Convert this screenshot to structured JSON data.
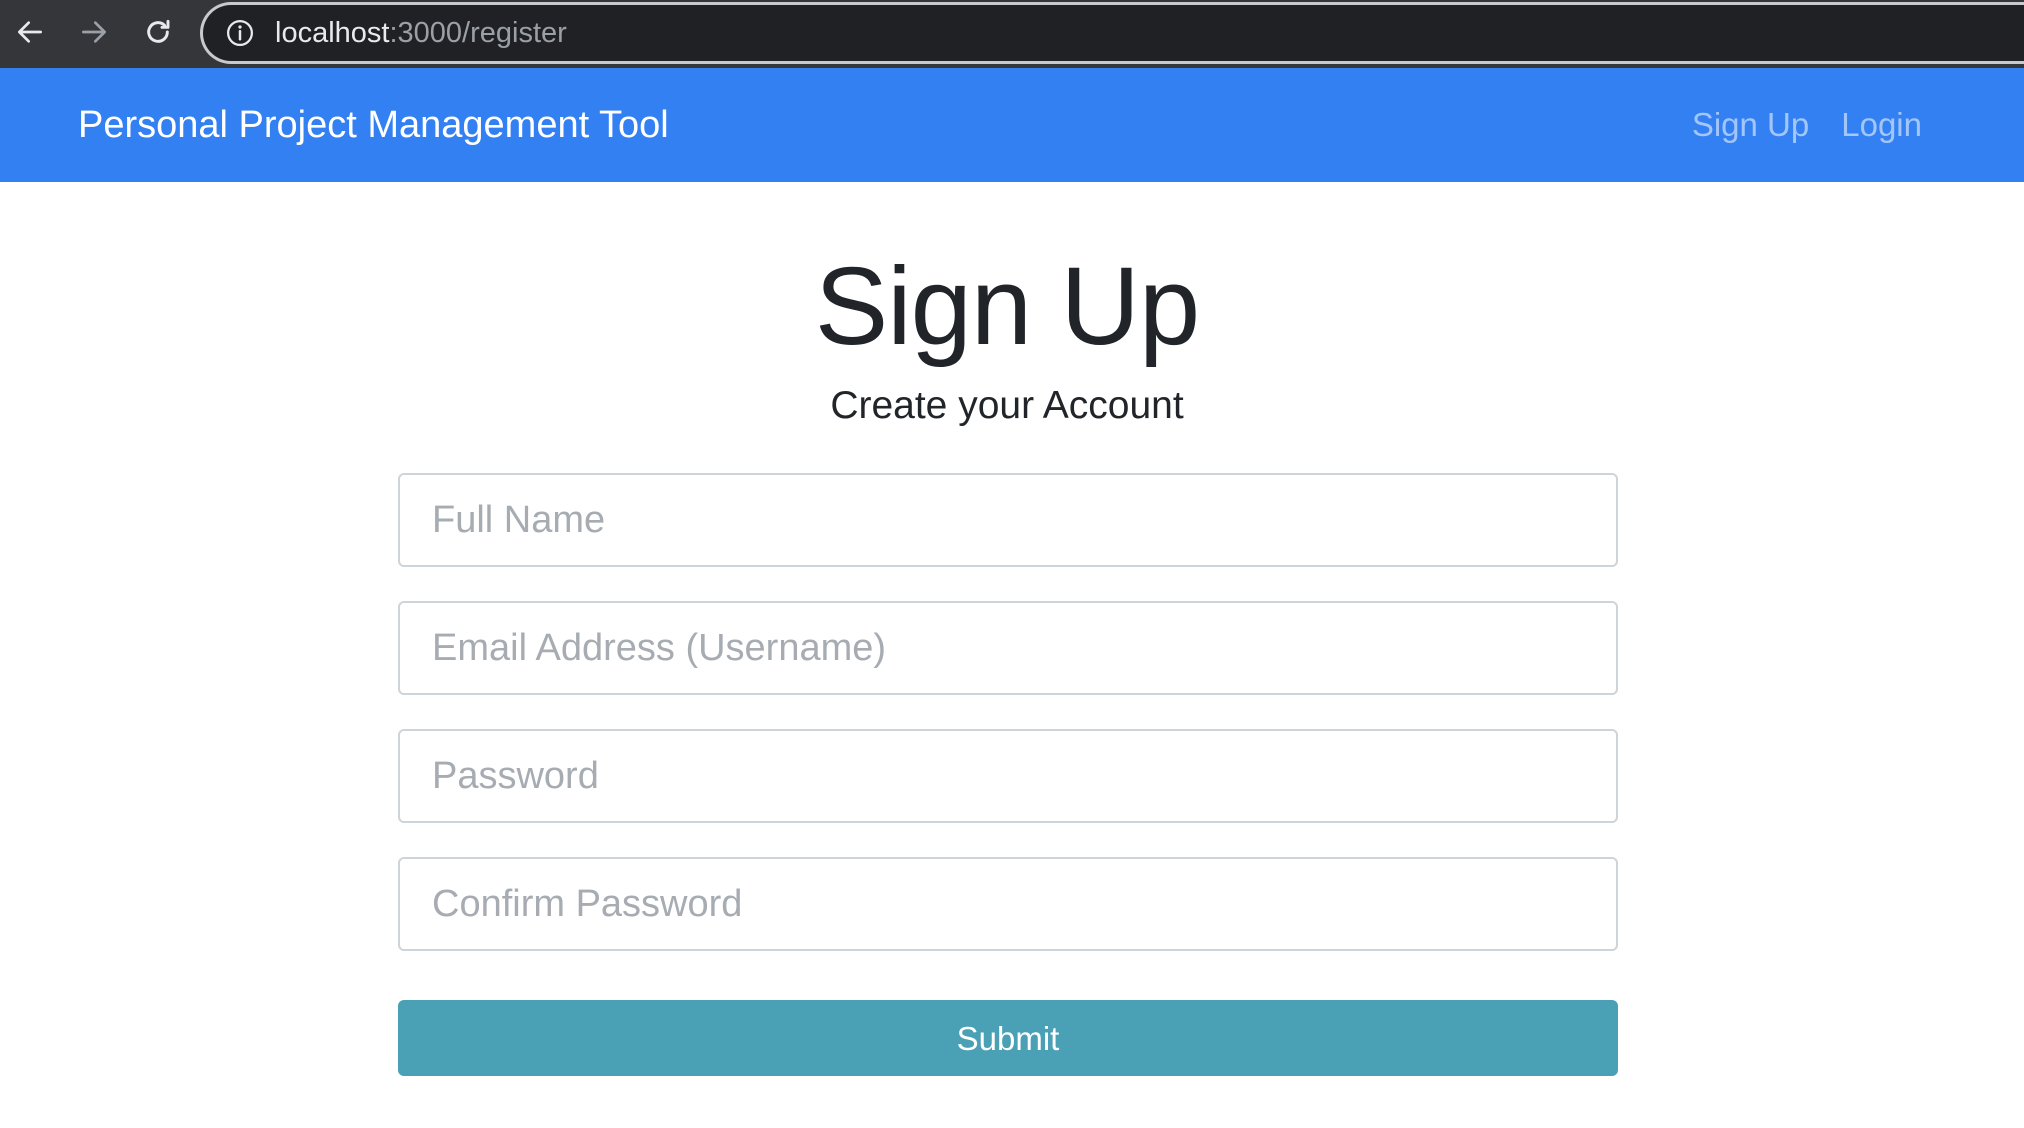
{
  "browser": {
    "url_host": "localhost",
    "url_path": ":3000/register",
    "icons": {
      "back": "arrow-left-icon",
      "forward": "arrow-right-icon",
      "reload": "reload-icon",
      "info": "info-icon"
    }
  },
  "navbar": {
    "brand": "Personal Project Management Tool",
    "links": [
      {
        "label": "Sign Up"
      },
      {
        "label": "Login"
      }
    ],
    "background_color": "#3380f3"
  },
  "page": {
    "title": "Sign Up",
    "subtitle": "Create your Account"
  },
  "form": {
    "full_name": {
      "placeholder": "Full Name",
      "value": ""
    },
    "email": {
      "placeholder": "Email Address (Username)",
      "value": ""
    },
    "password": {
      "placeholder": "Password",
      "value": ""
    },
    "confirm_password": {
      "placeholder": "Confirm Password",
      "value": ""
    },
    "submit_label": "Submit",
    "submit_color": "#4aa0b5"
  }
}
